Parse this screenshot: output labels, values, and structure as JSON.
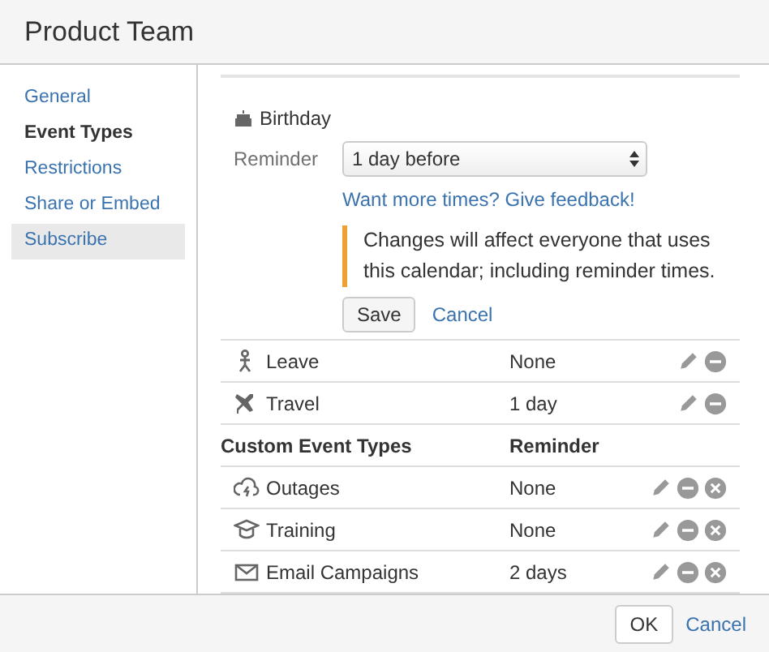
{
  "window": {
    "title": "Product Team"
  },
  "sidebar": {
    "items": [
      {
        "label": "General",
        "selected": false,
        "hovered": false
      },
      {
        "label": "Event Types",
        "selected": true,
        "hovered": false
      },
      {
        "label": "Restrictions",
        "selected": false,
        "hovered": false
      },
      {
        "label": "Share or Embed",
        "selected": false,
        "hovered": false
      },
      {
        "label": "Subscribe",
        "selected": false,
        "hovered": true
      }
    ]
  },
  "editor": {
    "event": "Birthday",
    "reminder_label": "Reminder",
    "reminder_value": "1 day before",
    "feedback_link": "Want more times? Give feedback!",
    "notice": "Changes will affect everyone that uses this calendar; including reminder times.",
    "save": "Save",
    "cancel": "Cancel"
  },
  "event_types": [
    {
      "name": "Leave",
      "kind": "leave",
      "reminder": "None",
      "deletable": false
    },
    {
      "name": "Travel",
      "kind": "travel",
      "reminder": "1 day",
      "deletable": false
    }
  ],
  "custom_header": {
    "column_1": "Custom Event Types",
    "column_2": "Reminder"
  },
  "custom_event_types": [
    {
      "name": "Outages",
      "kind": "outage",
      "reminder": "None",
      "deletable": true
    },
    {
      "name": "Training",
      "kind": "training",
      "reminder": "None",
      "deletable": true
    },
    {
      "name": "Email Campaigns",
      "kind": "email",
      "reminder": "2 days",
      "deletable": true
    }
  ],
  "footer": {
    "ok": "OK",
    "cancel": "Cancel"
  }
}
